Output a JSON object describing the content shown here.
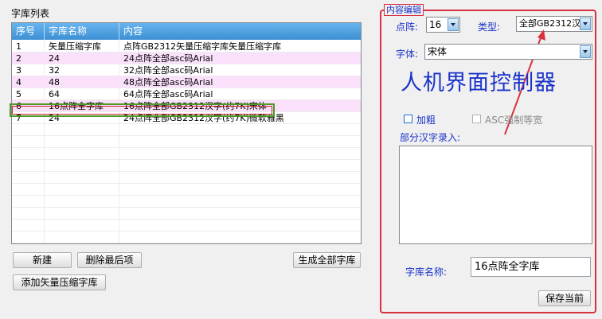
{
  "list_title": "字库列表",
  "table": {
    "columns": [
      "序号",
      "字库名称",
      "内容"
    ],
    "rows": [
      [
        "1",
        "矢量压缩字库",
        "点阵GB2312矢量压缩字库矢量压缩字库"
      ],
      [
        "2",
        "24",
        "24点阵全部asc码Arial"
      ],
      [
        "3",
        "32",
        "32点阵全部asc码Arial"
      ],
      [
        "4",
        "48",
        "48点阵全部asc码Arial"
      ],
      [
        "5",
        "64",
        "64点阵全部asc码Arial"
      ],
      [
        "6",
        "16点阵全字库",
        "16点阵全部GB2312汉字(约7K)宋体"
      ],
      [
        "7",
        "24",
        "24点阵全部GB2312汉字(约7K)微软雅黑"
      ]
    ],
    "highlighted_row": "6"
  },
  "buttons": {
    "new": "新建",
    "delete_last": "删除最后项",
    "generate_all": "生成全部字库",
    "add_vector": "添加矢量压缩字库",
    "save_current": "保存当前"
  },
  "editor": {
    "group_title": "内容编辑",
    "dot_matrix_label": "点阵:",
    "dot_matrix_value": "16",
    "type_label": "类型:",
    "type_value": "全部GB2312汉",
    "font_label": "字体:",
    "font_value": "宋体",
    "preview_text": "人机界面控制器",
    "bold_label": "加粗",
    "ascii_monospace_label": "ASC强制等宽",
    "partial_input_label": "部分汉字录入:",
    "partial_input_value": "",
    "name_label": "字库名称:",
    "name_value": "16点阵全字库"
  },
  "colors": {
    "accent_blue": "#1a33c8",
    "header_blue": "#4a9ee0",
    "alt_row_pink": "#fbe0fb",
    "group_red": "#d8313f",
    "highlight_green": "#4b9a2a"
  }
}
